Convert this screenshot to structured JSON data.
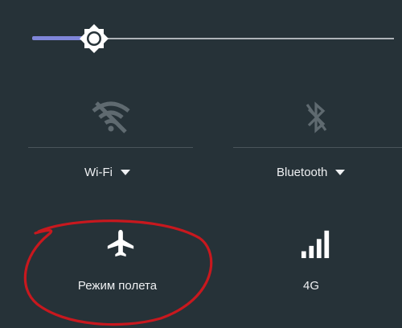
{
  "brightness": {
    "level": 0.17,
    "accent_color": "#7f86d9"
  },
  "tiles": {
    "wifi": {
      "label": "Wi-Fi",
      "icon": "wifi-off-icon",
      "enabled": false
    },
    "bluetooth": {
      "label": "Bluetooth",
      "icon": "bluetooth-off-icon",
      "enabled": false
    },
    "airplane": {
      "label": "Режим полета",
      "icon": "airplane-icon",
      "enabled": true
    },
    "cellular": {
      "label": "4G",
      "icon": "signal-bars-icon",
      "enabled": true
    }
  },
  "annotation": {
    "shape": "hand-drawn-circle",
    "color": "#c8181e",
    "target": "airplane"
  },
  "colors": {
    "background": "#263238",
    "icon_dim": "#5f6a70",
    "icon_active": "#ffffff"
  }
}
